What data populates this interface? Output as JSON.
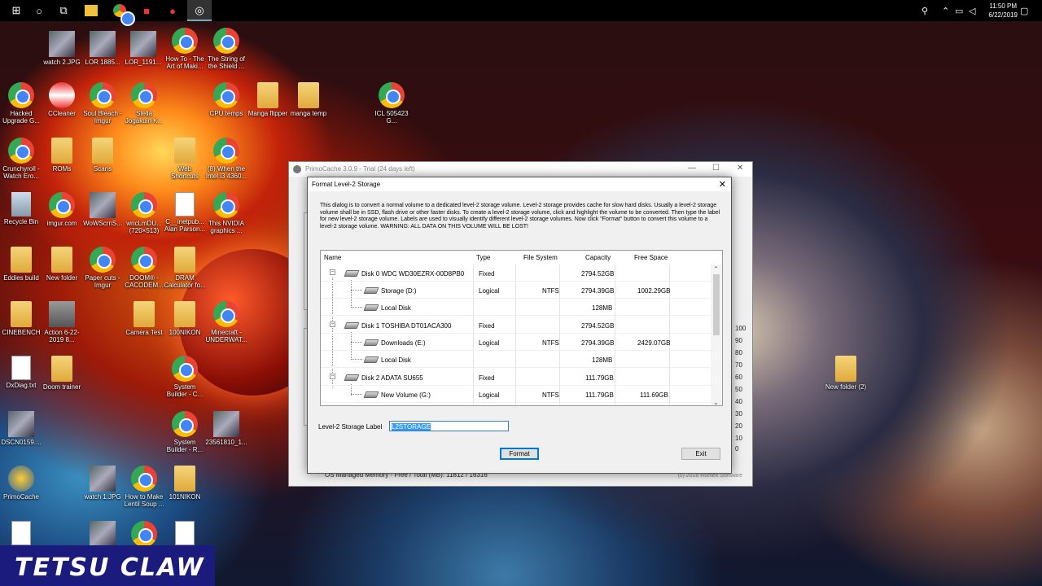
{
  "taskbar": {
    "clock_time": "11:50 PM",
    "clock_date": "6/22/2019"
  },
  "desktop_icons": [
    {
      "label": "watch 2.JPG",
      "type": "photo"
    },
    {
      "label": "LOR 1885...",
      "type": "photo"
    },
    {
      "label": "LOR_1191...",
      "type": "photo"
    },
    {
      "label": "How To - The Art of Maki...",
      "type": "chrome"
    },
    {
      "label": "The String of the Shield ...",
      "type": "chrome"
    },
    {
      "label": "Hacked Upgrade G...",
      "type": "chrome"
    },
    {
      "label": "CCleaner",
      "type": "app"
    },
    {
      "label": "Soul Bleach - Imgur",
      "type": "chrome"
    },
    {
      "label": "Stella Jogakuin K...",
      "type": "chrome"
    },
    {
      "label": "CPU temps",
      "type": "chrome"
    },
    {
      "label": "Manga flipper",
      "type": "folder"
    },
    {
      "label": "manga temp",
      "type": "folder"
    },
    {
      "label": "ICL 505423 G...",
      "type": "chrome"
    },
    {
      "label": "Crunchyroll - Watch Ero...",
      "type": "chrome"
    },
    {
      "label": "ROMs",
      "type": "folder"
    },
    {
      "label": "Scans",
      "type": "folder"
    },
    {
      "label": "Web Shortcuts",
      "type": "folder"
    },
    {
      "label": "(8) When the Intel i3 4360...",
      "type": "chrome"
    },
    {
      "label": "Recycle Bin",
      "type": "app"
    },
    {
      "label": "imgur.com",
      "type": "chrome"
    },
    {
      "label": "WoWScrnS...",
      "type": "photo"
    },
    {
      "label": "wncLmDU... (720×513)",
      "type": "chrome"
    },
    {
      "label": "C__inetpub... Alan Parson...",
      "type": "file"
    },
    {
      "label": "This NVIDIA graphics ...",
      "type": "chrome"
    },
    {
      "label": "Eddies build",
      "type": "folder"
    },
    {
      "label": "New folder",
      "type": "folder"
    },
    {
      "label": "Paper cuts - Imgur",
      "type": "chrome"
    },
    {
      "label": "DOOM® - CACODEM...",
      "type": "chrome"
    },
    {
      "label": "DRAM Calculator fo...",
      "type": "folder"
    },
    {
      "label": "CINEBENCH",
      "type": "folder"
    },
    {
      "label": "Action 6-22-2019 8...",
      "type": "app"
    },
    {
      "label": "Camera Test",
      "type": "folder"
    },
    {
      "label": "100NIKON",
      "type": "folder"
    },
    {
      "label": "Minecraft - UNDERWAT...",
      "type": "chrome"
    },
    {
      "label": "DxDiag.txt",
      "type": "file"
    },
    {
      "label": "Doom trainer",
      "type": "folder"
    },
    {
      "label": "System Builder - C...",
      "type": "chrome"
    },
    {
      "label": "DSCN0159....",
      "type": "photo"
    },
    {
      "label": "System Builder - R...",
      "type": "chrome"
    },
    {
      "label": "23561810_1...",
      "type": "photo"
    },
    {
      "label": "PrimoCache",
      "type": "app"
    },
    {
      "label": "watch 1.JPG",
      "type": "photo"
    },
    {
      "label": "How to Make Lentil Soup ...",
      "type": "chrome"
    },
    {
      "label": "101NIKON",
      "type": "folder"
    },
    {
      "label": "New folder (2)",
      "type": "folder"
    }
  ],
  "main_window": {
    "title": "PrimoCache 3.0.9 - Trial (24 days left)",
    "memory_text": "OS Managed Memory - Free / Total (MB):   11812 / 16316",
    "copyright": "(c) 2018 Romex Software",
    "graph_numbers": [
      "100",
      "90",
      "80",
      "70",
      "60",
      "50",
      "40",
      "30",
      "20",
      "10",
      "0"
    ]
  },
  "dialog": {
    "title": "Format Level-2 Storage",
    "description": "This dialog is to convert a normal volume to a dedicated level-2 storage volume. Level-2 storage provides cache for slow hard disks. Usually a level-2 storage volume shall be in SSD, flash drive or other faster disks. To create a level-2 storage volume, click and highlight the volume to be converted. Then type the label for new level-2 storage volume. Labels are used to visually identify different level-2 storage volumes. Now click \"Format\" button to convert this volume to a level-2 storage volume. WARNING: ALL DATA ON THIS VOLUME WILL BE LOST!",
    "columns": [
      "Name",
      "Type",
      "File System",
      "Capacity",
      "Free Space"
    ],
    "rows": [
      {
        "name": "Disk 0 WDC WD30EZRX-00D8PB0",
        "type": "Fixed",
        "fs": "",
        "capacity": "2794.52GB",
        "free": "",
        "level": 0
      },
      {
        "name": "Storage (D:)",
        "type": "Logical",
        "fs": "NTFS",
        "capacity": "2794.39GB",
        "free": "1002.29GB",
        "level": 1
      },
      {
        "name": "Local Disk",
        "type": "",
        "fs": "",
        "capacity": "128MB",
        "free": "",
        "level": 1
      },
      {
        "name": "Disk 1 TOSHIBA DT01ACA300",
        "type": "Fixed",
        "fs": "",
        "capacity": "2794.52GB",
        "free": "",
        "level": 0
      },
      {
        "name": "Downloads (E:)",
        "type": "Logical",
        "fs": "NTFS",
        "capacity": "2794.39GB",
        "free": "2429.07GB",
        "level": 1
      },
      {
        "name": "Local Disk",
        "type": "",
        "fs": "",
        "capacity": "128MB",
        "free": "",
        "level": 1
      },
      {
        "name": "Disk 2 ADATA SU655",
        "type": "Fixed",
        "fs": "",
        "capacity": "111.79GB",
        "free": "",
        "level": 0
      },
      {
        "name": "New Volume (G:)",
        "type": "Logical",
        "fs": "NTFS",
        "capacity": "111.79GB",
        "free": "111.69GB",
        "level": 1
      }
    ],
    "label_caption": "Level-2 Storage Label",
    "label_value": "L2STORAGE",
    "format_button": "Format",
    "exit_button": "Exit"
  },
  "watermark": "TETSU CLAW"
}
